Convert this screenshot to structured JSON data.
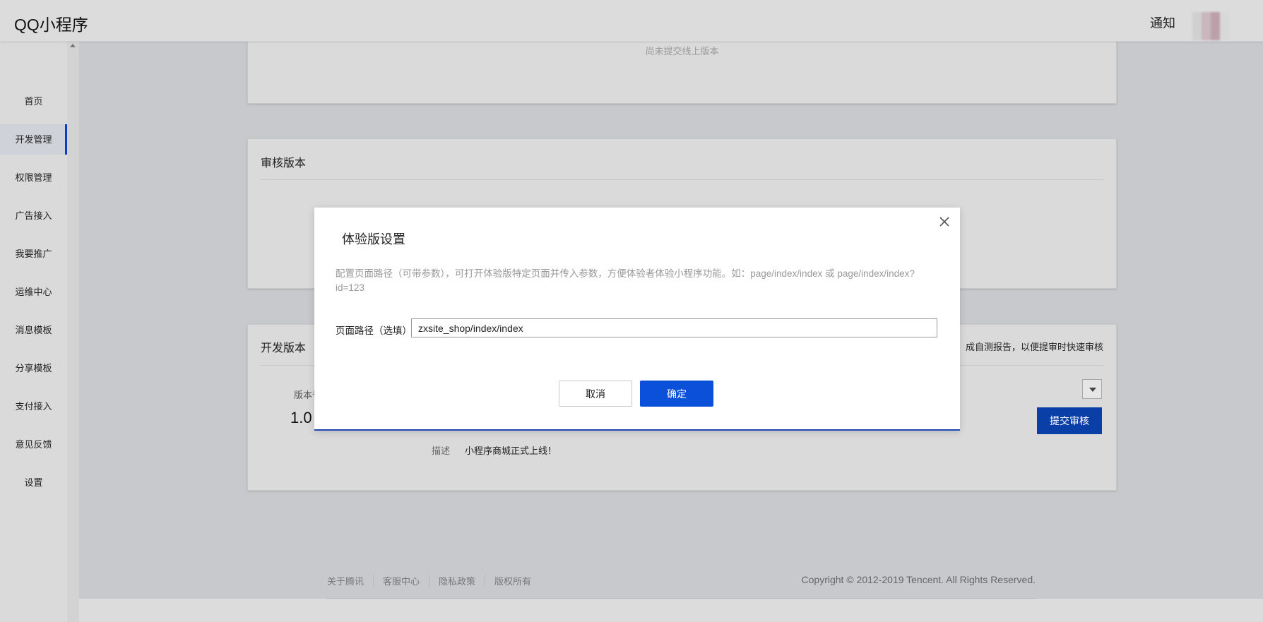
{
  "header": {
    "brand": "QQ小程序",
    "notice": "通知"
  },
  "sidebar": {
    "items": [
      {
        "label": "首页"
      },
      {
        "label": "开发管理"
      },
      {
        "label": "权限管理"
      },
      {
        "label": "广告接入"
      },
      {
        "label": "我要推广"
      },
      {
        "label": "运维中心"
      },
      {
        "label": "消息模板"
      },
      {
        "label": "分享模板"
      },
      {
        "label": "支付接入"
      },
      {
        "label": "意见反馈"
      },
      {
        "label": "设置"
      }
    ],
    "active": "开发管理"
  },
  "online_card": {
    "empty_text": "尚未提交线上版本"
  },
  "review_card": {
    "title": "审核版本"
  },
  "dev_card": {
    "title": "开发版本",
    "version_label": "版本号",
    "version_value": "1.0",
    "hint": "成自测报告，以便提审时快速审核",
    "desc_label": "描述",
    "desc_value": "小程序商城正式上线！",
    "submit_label": "提交审核"
  },
  "modal": {
    "title": "体验版设置",
    "description": "配置页面路径（可带参数），可打开体验版特定页面并传入参数，方便体验者体验小程序功能。如：page/index/index 或 page/index/index?id=123",
    "path_label": "页面路径（选填）",
    "path_value": "zxsite_shop/index/index",
    "cancel_label": "取消",
    "ok_label": "确定"
  },
  "footer": {
    "links": [
      "关于腾讯",
      "客服中心",
      "隐私政策",
      "版权所有"
    ],
    "copyright": "Copyright © 2012-2019 Tencent. All Rights Reserved."
  }
}
